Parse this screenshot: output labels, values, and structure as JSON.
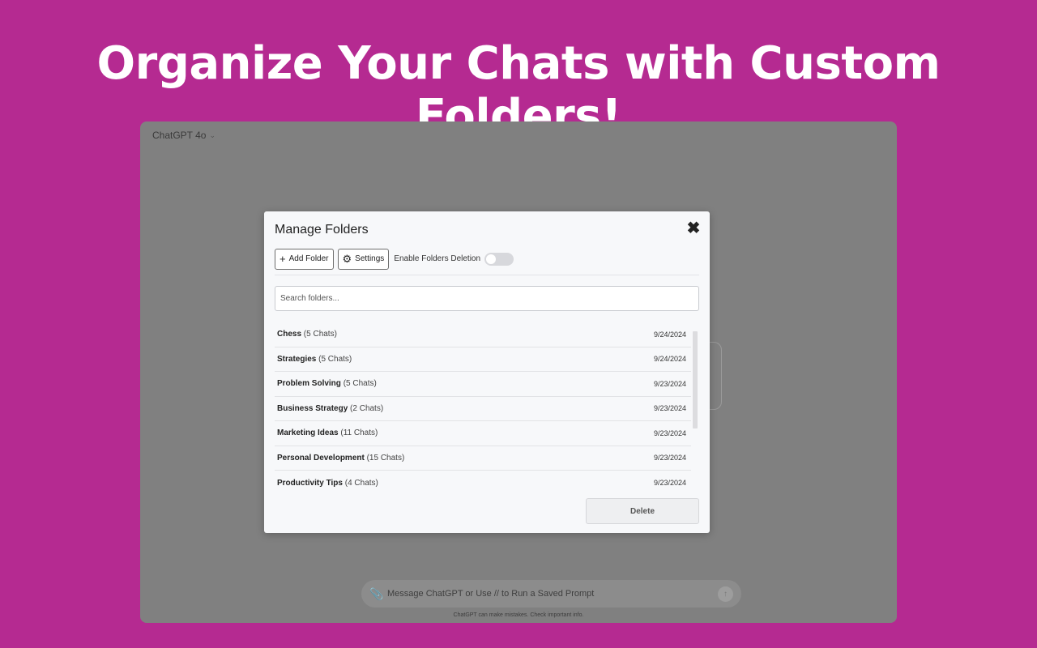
{
  "banner": {
    "headline": "Organize Your Chats with Custom Folders!"
  },
  "app": {
    "model_label": "ChatGPT 4o",
    "composer_placeholder": "Message ChatGPT or Use // to Run a Saved Prompt",
    "disclaimer": "ChatGPT can make mistakes. Check important info."
  },
  "modal": {
    "title": "Manage Folders",
    "add_folder_label": "Add Folder",
    "settings_label": "Settings",
    "toggle_label": "Enable Folders Deletion",
    "toggle_on": false,
    "search_placeholder": "Search folders...",
    "delete_label": "Delete",
    "folders": [
      {
        "name": "Chess",
        "count": "(5 Chats)",
        "date": "9/24/2024"
      },
      {
        "name": "Strategies",
        "count": "(5 Chats)",
        "date": "9/24/2024"
      },
      {
        "name": "Problem Solving",
        "count": "(5 Chats)",
        "date": "9/23/2024"
      },
      {
        "name": "Business Strategy",
        "count": "(2 Chats)",
        "date": "9/23/2024"
      },
      {
        "name": "Marketing Ideas",
        "count": "(11 Chats)",
        "date": "9/23/2024"
      },
      {
        "name": "Personal Development",
        "count": "(15 Chats)",
        "date": "9/23/2024"
      },
      {
        "name": "Productivity Tips",
        "count": "(4 Chats)",
        "date": "9/23/2024"
      }
    ]
  },
  "colors": {
    "background": "#b52a91",
    "overlay": "#808080",
    "modal_bg": "#f7f8fa"
  },
  "icons": {
    "close": "close-icon",
    "add": "plus-icon",
    "settings": "gear-icon",
    "attach": "paperclip-icon",
    "send": "arrow-up-icon",
    "model_dropdown": "chevron-down-icon"
  }
}
